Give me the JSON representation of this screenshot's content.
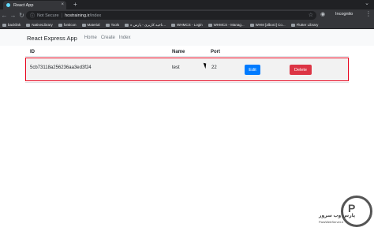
{
  "browser": {
    "tab_title": "React App",
    "tab_close": "×",
    "new_tab": "+",
    "window_control": "⌄",
    "nav": {
      "back": "←",
      "forward": "→",
      "reload": "↻"
    },
    "not_secure": "Not Secure",
    "separator": "|",
    "url_host": "hostraining.ir",
    "url_path": "/index",
    "star_icon": "☆",
    "incognito_icon": "◉",
    "incognito_label": "Incognito",
    "menu_icon": "⋮",
    "bookmarks": [
      "backlink",
      "NativeLibrary",
      "fonticon",
      "Material",
      "Tools",
      "ناحیه کاربری - پارس ه...",
      "WHMCS - Login",
      "WHMCS - Manag...",
      "WHM [alborz] Co...",
      "Flutter Library"
    ]
  },
  "app": {
    "brand": "React Express App",
    "links": [
      "Home",
      "Create",
      "Index"
    ]
  },
  "table": {
    "headers": {
      "id": "ID",
      "name": "Name",
      "port": "Port"
    },
    "rows": [
      {
        "id": "5cb73118a256236aa3ed3f24",
        "name": "test",
        "port": "22",
        "edit": "Edit",
        "delete": "Delete"
      }
    ]
  },
  "watermark": {
    "symbol": "P",
    "text": "پارس وب سرور",
    "sub": "ParsWebServer.ir"
  },
  "colors": {
    "primary": "#007bff",
    "danger": "#dc3545",
    "highlight": "#e8001a"
  }
}
